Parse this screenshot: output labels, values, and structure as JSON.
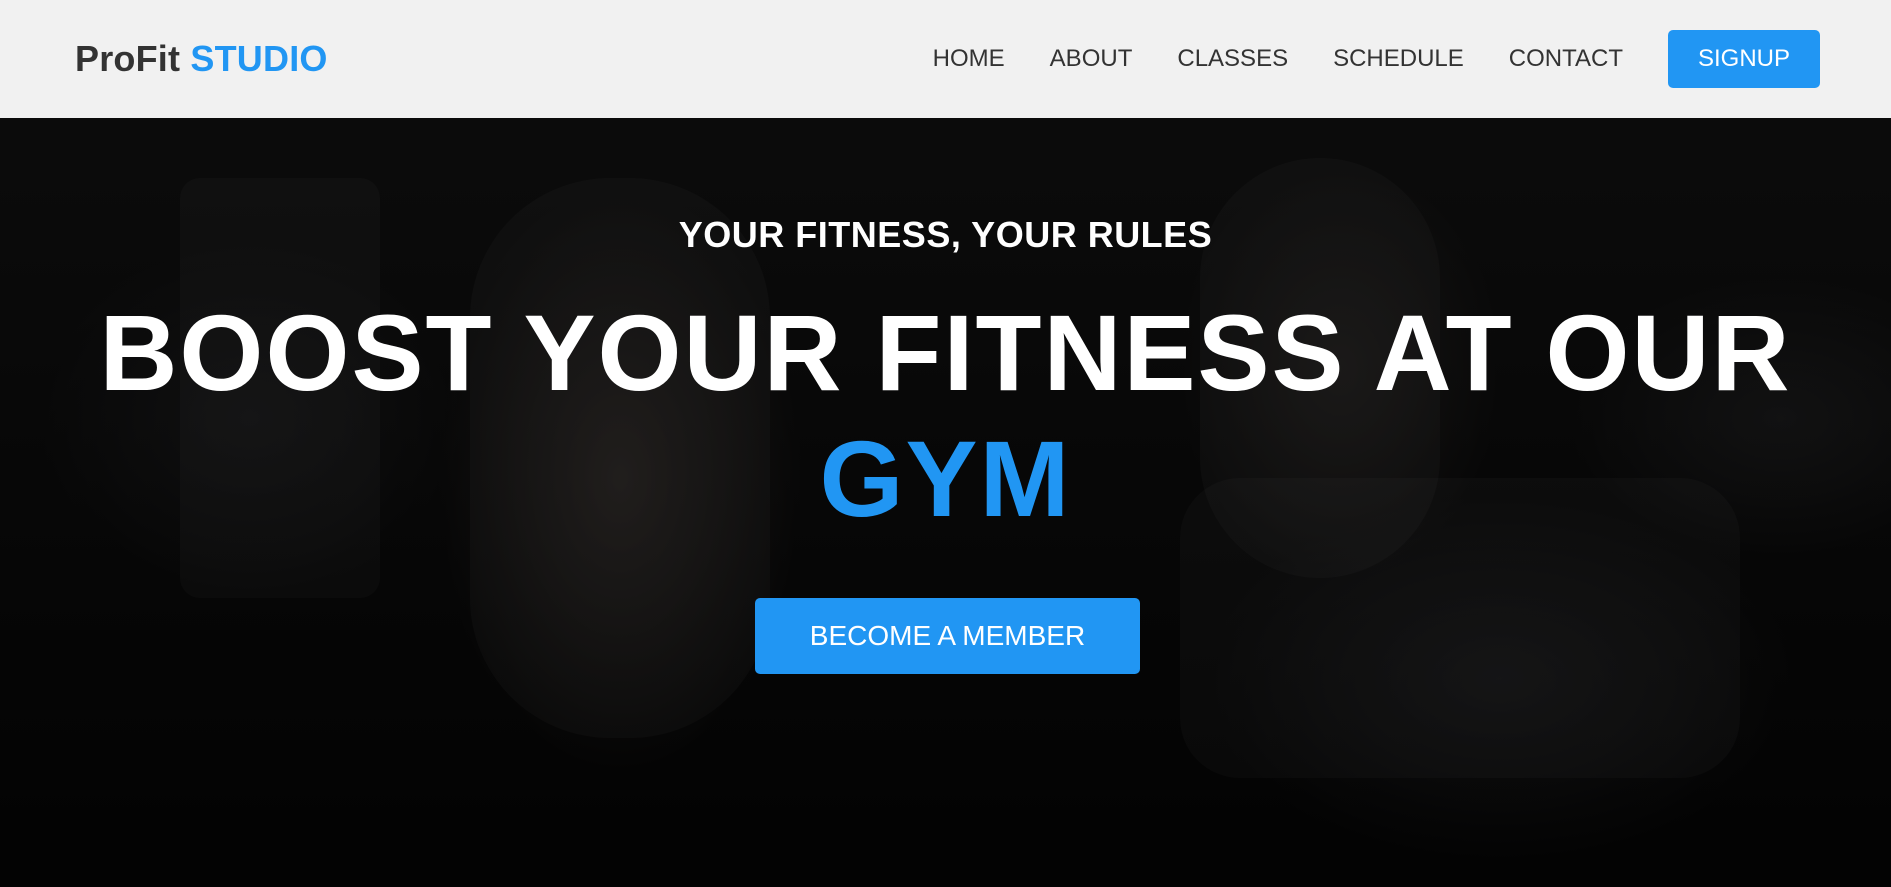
{
  "header": {
    "logo_main": "ProFit",
    "logo_accent": "STUDIO",
    "nav": [
      {
        "label": "HOME"
      },
      {
        "label": "ABOUT"
      },
      {
        "label": "CLASSES"
      },
      {
        "label": "SCHEDULE"
      },
      {
        "label": "CONTACT"
      }
    ],
    "signup_label": "SIGNUP"
  },
  "hero": {
    "tagline": "YOUR FITNESS, YOUR RULES",
    "headline_main": "BOOST YOUR FITNESS AT OUR",
    "headline_accent": "GYM",
    "cta_label": "BECOME A MEMBER",
    "background_image": "gym-cycling-class-photo"
  },
  "colors": {
    "accent": "#2196f3",
    "header_bg": "#f1f1f1",
    "text_dark": "#333333",
    "text_light": "#ffffff"
  }
}
